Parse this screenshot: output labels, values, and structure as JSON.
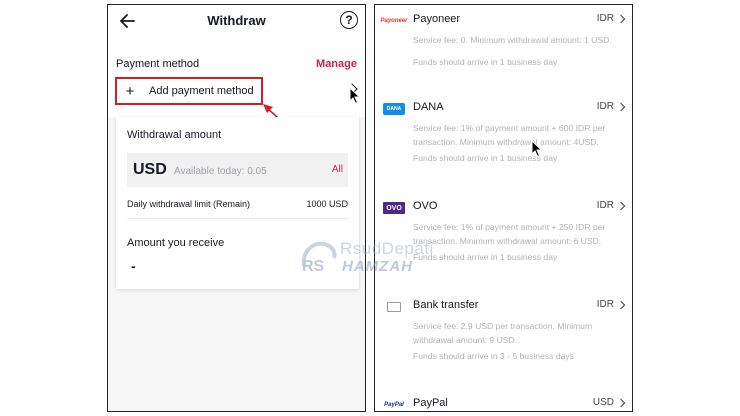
{
  "withdraw": {
    "title": "Withdraw",
    "help_icon": "?",
    "payment_method_label": "Payment method",
    "manage_label": "Manage",
    "add_payment_method_label": "Add payment method",
    "add_icon": "+",
    "withdrawal_amount_label": "Withdrawal amount",
    "currency": "USD",
    "available_today": "Available today: 0.05",
    "all_label": "All",
    "daily_limit_label": "Daily withdrawal limit (Remain)",
    "daily_limit_value": "1000 USD",
    "amount_receive_label": "Amount you receive",
    "amount_receive_value": "-"
  },
  "payment_options": [
    {
      "name": "Payoneer",
      "logo_text": "Payoneer",
      "currency": "IDR",
      "fee": "Service fee:  0. Minimum withdrawal amount: 1 USD.",
      "arrival": "Funds should arrive in 1 business day"
    },
    {
      "name": "DANA",
      "logo_text": "DANA",
      "currency": "IDR",
      "fee": "Service fee:  1% of payment amount + 600 IDR per transaction. Minimum withdrawal amount: 4USD.",
      "arrival": "Funds should arrive in 1 business day"
    },
    {
      "name": "OVO",
      "logo_text": "OVO",
      "currency": "IDR",
      "fee": "Service fee:  1% of payment amount + 250 IDR per transaction. Minimum withdrawal amount: 6 USD.",
      "arrival": "Funds should arrive in 1 business day"
    },
    {
      "name": "Bank transfer",
      "logo_text": "",
      "currency": "IDR",
      "fee": "Service fee:  2.9 USD per transaction. Minimum withdrawal amount: 9 USD.",
      "arrival": "Funds should arrive in 3 - 5 business days"
    },
    {
      "name": "PayPal",
      "logo_text": "PayPal",
      "currency": "USD",
      "fee": "",
      "arrival": ""
    }
  ],
  "watermark": {
    "line1": "RsudDepati",
    "line2": "HAMZAH"
  },
  "colors": {
    "accent": "#c2264e",
    "highlight_box": "#d21f26",
    "muted_text": "#b2b3b8"
  }
}
